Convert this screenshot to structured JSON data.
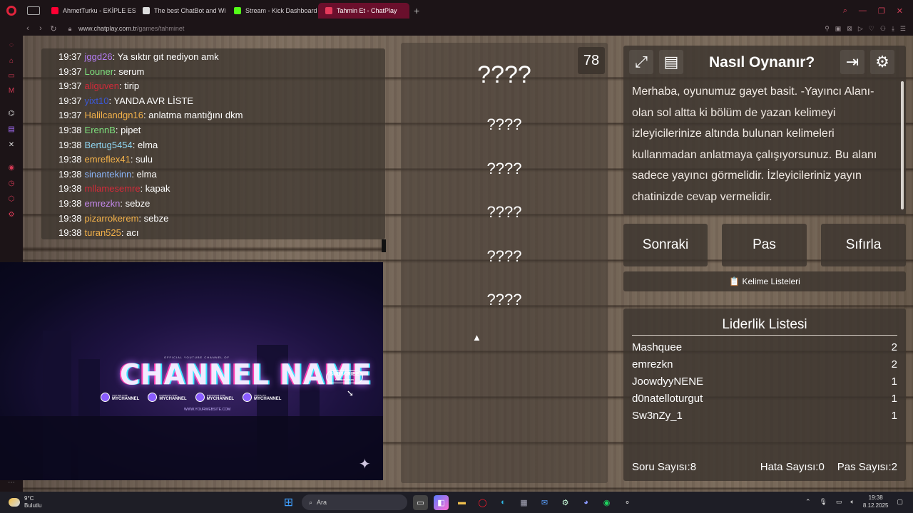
{
  "browser": {
    "tabs": [
      {
        "label": "AhmetTurku - EKİPLE ESK",
        "fav": "yt",
        "color": "#ff0033",
        "active": false
      },
      {
        "label": "The best ChatBot and Wi",
        "fav": "cb",
        "color": "#dddddd",
        "active": false
      },
      {
        "label": "Stream - Kick Dashboard",
        "fav": "K",
        "color": "#53fc18",
        "active": false
      },
      {
        "label": "Tahmin Et - ChatPlay",
        "fav": "CP",
        "color": "#e53a5b",
        "active": true
      }
    ],
    "new_tab": "+",
    "url_host": "www.chatplay.com.tr",
    "url_path": "/games/tahminet"
  },
  "chat": {
    "messages": [
      {
        "time": "19:37",
        "user": "jggd26",
        "color": "#b57cf5",
        "text": ": Ya sıktır gıt nediyon amk"
      },
      {
        "time": "19:37",
        "user": "Louner",
        "color": "#7ee07e",
        "text": ": serum"
      },
      {
        "time": "19:37",
        "user": "aliguven",
        "color": "#d42a3a",
        "text": ": tirip"
      },
      {
        "time": "19:37",
        "user": "yixt10",
        "color": "#3b58d6",
        "text": ": YANDA AVR LİSTE"
      },
      {
        "time": "19:37",
        "user": "Halilcandgn16",
        "color": "#f4b24a",
        "text": ": anlatma mantığını dkm"
      },
      {
        "time": "19:38",
        "user": "ErennB",
        "color": "#7ee07e",
        "text": ": pipet"
      },
      {
        "time": "19:38",
        "user": "Bertug5454",
        "color": "#8fd6f2",
        "text": ": elma"
      },
      {
        "time": "19:38",
        "user": "emreflex41",
        "color": "#f4b24a",
        "text": ": sulu"
      },
      {
        "time": "19:38",
        "user": "sinantekinn",
        "color": "#8ab4f8",
        "text": ": elma"
      },
      {
        "time": "19:38",
        "user": "mllamesemre",
        "color": "#d42a3a",
        "text": ": kapak"
      },
      {
        "time": "19:38",
        "user": "emrezkn",
        "color": "#c78af0",
        "text": ": sebze"
      },
      {
        "time": "19:38",
        "user": "pizarrokerem",
        "color": "#f4b24a",
        "text": ": sebze"
      },
      {
        "time": "19:38",
        "user": "turan525",
        "color": "#f4b24a",
        "text": ": acı"
      }
    ]
  },
  "preview": {
    "kicker": "OFFICIAL YOUTUBE CHANNEL OF",
    "title": "CHANNEL NAME",
    "subscribe": "SUBSCRIBE",
    "subscribe_sub": "FOR NEW VIDEOS",
    "socials": [
      {
        "top": "TWITTER.COM/",
        "name": "MYCHANNEL"
      },
      {
        "top": "FACEBOOK.COM/",
        "name": "MYCHANNEL"
      },
      {
        "top": "INSTAGRAM.COM/",
        "name": "MYCHANNEL"
      },
      {
        "top": "TWITCH.TV/",
        "name": "MYCHANNEL"
      }
    ],
    "website": "WWW.YOURWEBSITE.COM"
  },
  "words": {
    "timer": "78",
    "main": "????",
    "hints": [
      "????",
      "????",
      "????",
      "????",
      "????"
    ]
  },
  "how_to": {
    "title": "Nasıl Oynanır?",
    "text": "Merhaba, oyunumuz gayet basit. -Yayıncı Alanı- olan sol altta ki bölüm de yazan kelimeyi izleyicilerinize altında bulunan kelimeleri kullanmadan anlatmaya çalışıyorsunuz. Bu alanı sadece yayıncı görmelidir. İzleyicileriniz yayın chatinizde cevap vermelidir."
  },
  "actions": {
    "next": "Sonraki",
    "pass": "Pas",
    "reset": "Sıfırla"
  },
  "word_lists": {
    "icon": "📋",
    "label": "Kelime Listeleri"
  },
  "leaderboard": {
    "title": "Liderlik Listesi",
    "rows": [
      {
        "name": "Mashquee",
        "score": "2"
      },
      {
        "name": "emrezkn",
        "score": "2"
      },
      {
        "name": "JoowdyyNENE",
        "score": "1"
      },
      {
        "name": "d0natelloturgut",
        "score": "1"
      },
      {
        "name": "Sw3nZy_1",
        "score": "1"
      }
    ],
    "question_count_label": "Soru Sayısı:",
    "question_count": "8",
    "error_count_label": "Hata Sayısı:",
    "error_count": "0",
    "pass_count_label": "Pas Sayısı:",
    "pass_count": "2"
  },
  "taskbar": {
    "weather_temp": "9°C",
    "weather_desc": "Bulutlu",
    "search_placeholder": "Ara",
    "time": "19:38",
    "date": "8.12.2025"
  }
}
